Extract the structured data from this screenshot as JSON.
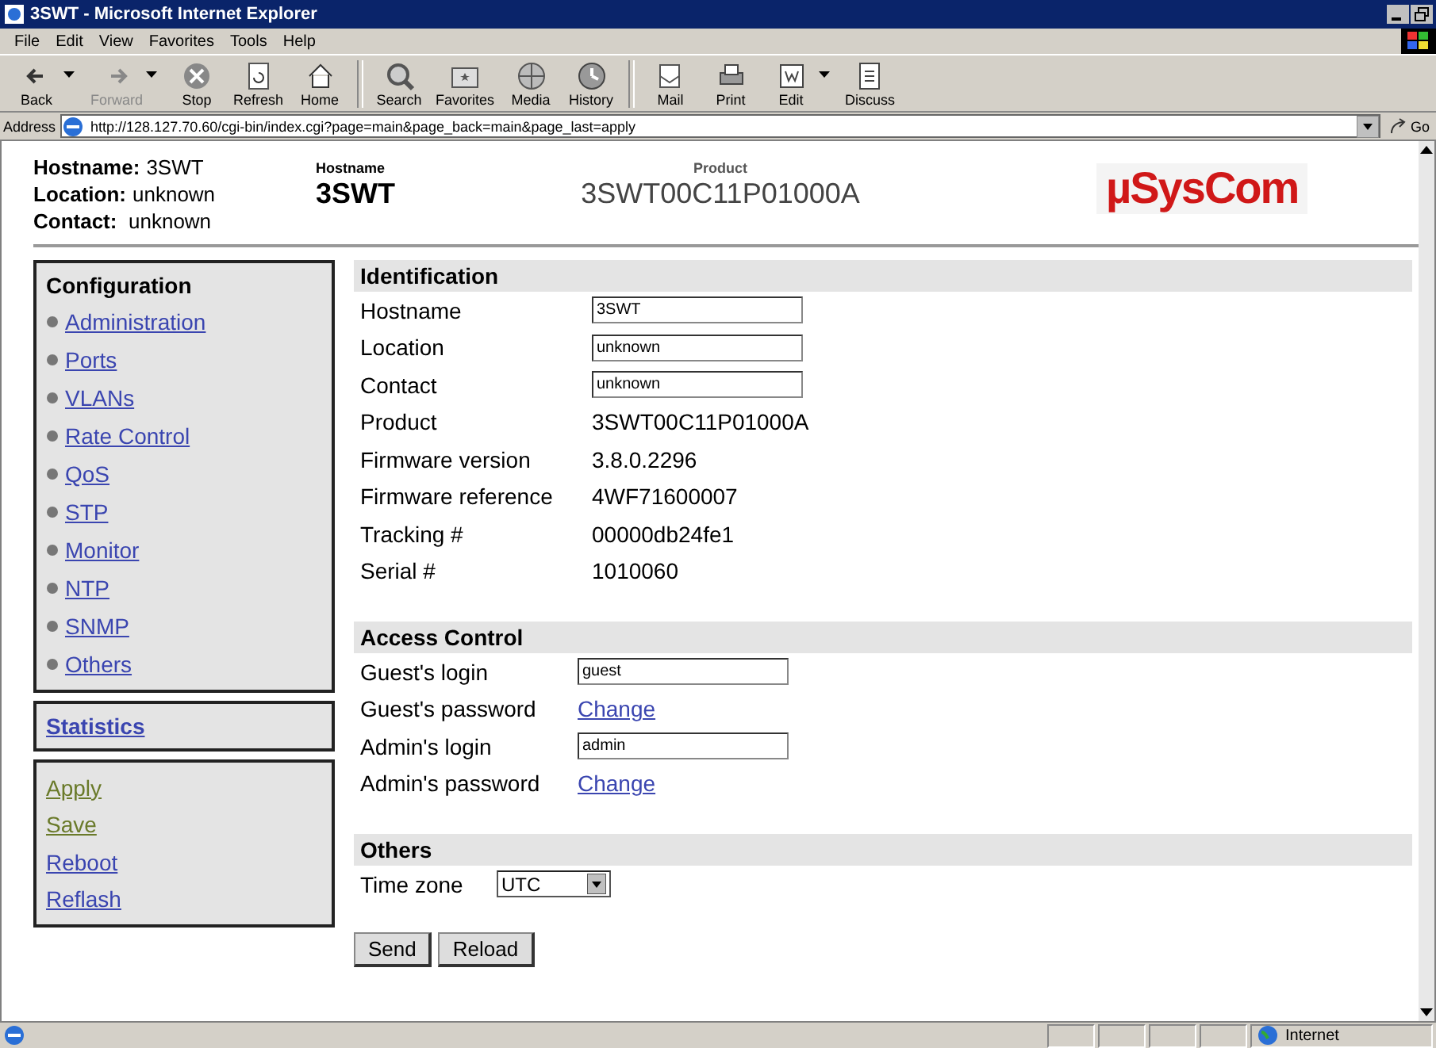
{
  "window": {
    "title": "3SWT - Microsoft Internet Explorer"
  },
  "menu_bar": [
    "File",
    "Edit",
    "View",
    "Favorites",
    "Tools",
    "Help"
  ],
  "toolbar": [
    {
      "kind": "back",
      "label": "Back",
      "disabled": false,
      "dropdown": true
    },
    {
      "kind": "forward",
      "label": "Forward",
      "disabled": true,
      "dropdown": true
    },
    {
      "kind": "stop",
      "label": "Stop",
      "disabled": false,
      "dropdown": false
    },
    {
      "kind": "refresh",
      "label": "Refresh",
      "disabled": false,
      "dropdown": false
    },
    {
      "kind": "home",
      "label": "Home",
      "disabled": false,
      "dropdown": false
    },
    {
      "kind": "search",
      "label": "Search",
      "disabled": false,
      "dropdown": false
    },
    {
      "kind": "favorites",
      "label": "Favorites",
      "disabled": false,
      "dropdown": false
    },
    {
      "kind": "media",
      "label": "Media",
      "disabled": false,
      "dropdown": false
    },
    {
      "kind": "history",
      "label": "History",
      "disabled": false,
      "dropdown": false
    },
    {
      "kind": "mail",
      "label": "Mail",
      "disabled": false,
      "dropdown": false
    },
    {
      "kind": "print",
      "label": "Print",
      "disabled": false,
      "dropdown": false
    },
    {
      "kind": "edit",
      "label": "Edit",
      "disabled": false,
      "dropdown": true
    },
    {
      "kind": "discuss",
      "label": "Discuss",
      "disabled": false,
      "dropdown": false
    }
  ],
  "address_bar": {
    "label": "Address",
    "url": "http://128.127.70.60/cgi-bin/index.cgi?page=main&page_back=main&page_last=apply",
    "go": "Go"
  },
  "header": {
    "info": [
      {
        "label": "Hostname:",
        "value": "3SWT"
      },
      {
        "label": "Location:",
        "value": "unknown"
      },
      {
        "label": "Contact:",
        "value": "unknown"
      }
    ],
    "hostname": {
      "label": "Hostname",
      "value": "3SWT"
    },
    "product": {
      "label": "Product",
      "value": "3SWT00C11P01000A"
    },
    "logo": "µSysCom"
  },
  "sidebar": {
    "configuration": {
      "title": "Configuration",
      "items": [
        "Administration",
        "Ports",
        "VLANs",
        "Rate Control",
        "QoS",
        "STP",
        "Monitor",
        "NTP",
        "SNMP",
        "Others"
      ]
    },
    "statistics": "Statistics",
    "actions": [
      {
        "label": "Apply",
        "visited": true
      },
      {
        "label": "Save",
        "visited": true
      },
      {
        "label": "Reboot",
        "visited": false
      },
      {
        "label": "Reflash",
        "visited": false
      }
    ]
  },
  "sections": [
    {
      "title": "Identification",
      "rows": [
        {
          "kind": "field",
          "label": "Hostname",
          "value": "3SWT"
        },
        {
          "kind": "field",
          "label": "Location",
          "value": "unknown"
        },
        {
          "kind": "field",
          "label": "Contact",
          "value": "unknown"
        },
        {
          "kind": "text",
          "label": "Product",
          "value": "3SWT00C11P01000A"
        },
        {
          "kind": "text",
          "label": "Firmware version",
          "value": "3.8.0.2296"
        },
        {
          "kind": "text",
          "label": "Firmware reference",
          "value": "4WF71600007"
        },
        {
          "kind": "text",
          "label": "Tracking #",
          "value": "00000db24fe1"
        },
        {
          "kind": "text",
          "label": "Serial #",
          "value": "1010060"
        }
      ]
    },
    {
      "title": "Access Control",
      "rows": [
        {
          "kind": "field",
          "label": "Guest's login",
          "value": "guest"
        },
        {
          "kind": "link",
          "label": "Guest's password",
          "value": "Change"
        },
        {
          "kind": "field",
          "label": "Admin's login",
          "value": "admin"
        },
        {
          "kind": "link",
          "label": "Admin's password",
          "value": "Change"
        }
      ]
    },
    {
      "title": "Others",
      "rows": [
        {
          "kind": "select",
          "label": "Time zone",
          "value": "UTC"
        }
      ]
    }
  ],
  "form_buttons": [
    "Send",
    "Reload"
  ],
  "status_bar": {
    "zone": "Internet"
  }
}
